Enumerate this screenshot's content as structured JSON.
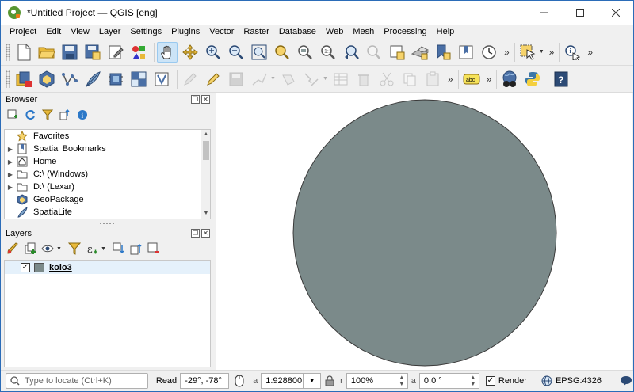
{
  "window": {
    "title": "*Untitled Project — QGIS [eng]"
  },
  "menu": [
    "Project",
    "Edit",
    "View",
    "Layer",
    "Settings",
    "Plugins",
    "Vector",
    "Raster",
    "Database",
    "Web",
    "Mesh",
    "Processing",
    "Help"
  ],
  "toolbar": {
    "overflow": "»"
  },
  "browser": {
    "title": "Browser",
    "items": [
      {
        "label": "Favorites",
        "icon": "star-icon"
      },
      {
        "label": "Spatial Bookmarks",
        "icon": "bookmarks-icon"
      },
      {
        "label": "Home",
        "icon": "home-icon"
      },
      {
        "label": "C:\\ (Windows)",
        "icon": "folder-icon"
      },
      {
        "label": "D:\\ (Lexar)",
        "icon": "folder-icon"
      },
      {
        "label": "GeoPackage",
        "icon": "geopackage-icon"
      },
      {
        "label": "SpatiaLite",
        "icon": "spatialite-icon"
      }
    ]
  },
  "layers": {
    "title": "Layers",
    "items": [
      {
        "label": "kolo3",
        "checked": "✓",
        "color": "#7b8a8a"
      }
    ]
  },
  "map": {
    "fill_color": "#7b8a8a",
    "stroke_color": "#3a3a3a"
  },
  "status": {
    "locator_placeholder": "Type to locate (Ctrl+K)",
    "coord_label": "Read",
    "coordinate": "-29°, -78°",
    "scale": "1:928800",
    "magnifier": "100%",
    "rotation": "0.0 °",
    "render_label": "Render",
    "render_checked": "✓",
    "crs": "EPSG:4326"
  }
}
